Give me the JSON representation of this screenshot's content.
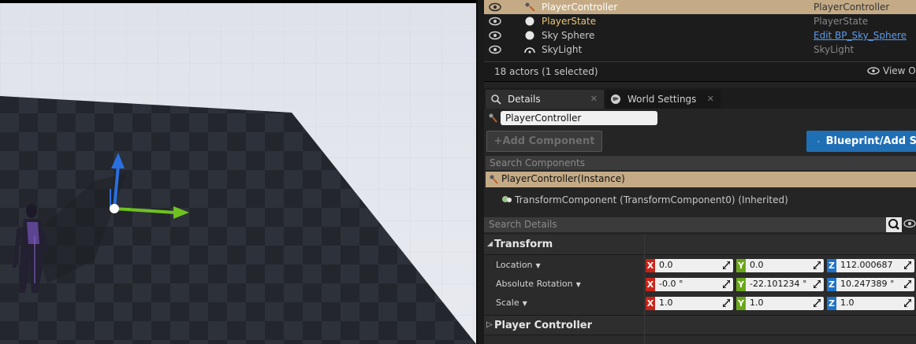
{
  "outliner": {
    "rows": [
      {
        "name": "PlayerController",
        "type": "PlayerController",
        "selected": true,
        "icon": "player-controller-icon"
      },
      {
        "name": "PlayerState",
        "type": "PlayerState",
        "selected": false,
        "icon": "sphere-icon"
      },
      {
        "name": "Sky Sphere",
        "type": "Edit BP_Sky_Sphere",
        "selected": false,
        "icon": "sphere-icon"
      },
      {
        "name": "SkyLight",
        "type": "SkyLight",
        "selected": false,
        "icon": "skylight-icon"
      }
    ],
    "status": "18 actors (1 selected)",
    "view_options": "View O"
  },
  "tabs": [
    {
      "label": "Details",
      "active": true,
      "icon": "details-icon"
    },
    {
      "label": "World Settings",
      "active": false,
      "icon": "globe-icon"
    }
  ],
  "details": {
    "actor_name": "PlayerController",
    "add_component": "+Add Component",
    "blueprint_button": "Blueprint/Add S",
    "search_components_placeholder": "Search Components",
    "instance_label": "PlayerController(Instance)",
    "transform_component": "TransformComponent (TransformComponent0) (Inherited)",
    "search_details_placeholder": "Search Details",
    "transform_category": "Transform",
    "player_controller_category": "Player Controller",
    "properties": [
      {
        "label": "Location",
        "x": "0.0",
        "y": "0.0",
        "z": "112.000687"
      },
      {
        "label": "Absolute Rotation",
        "x": "-0.0 °",
        "y": "-22.101234 °",
        "z": "10.247389 °"
      },
      {
        "label": "Scale",
        "x": "1.0",
        "y": "1.0",
        "z": "1.0"
      }
    ]
  },
  "axes": {
    "x": "X",
    "y": "Y",
    "z": "Z"
  },
  "colors": {
    "selection": "#c4ab86",
    "axis_x": "#c8251b",
    "axis_y": "#6ca71b",
    "axis_z": "#1e73c9",
    "blueprint_button": "#1f6fb5",
    "link": "#5d9be8"
  }
}
